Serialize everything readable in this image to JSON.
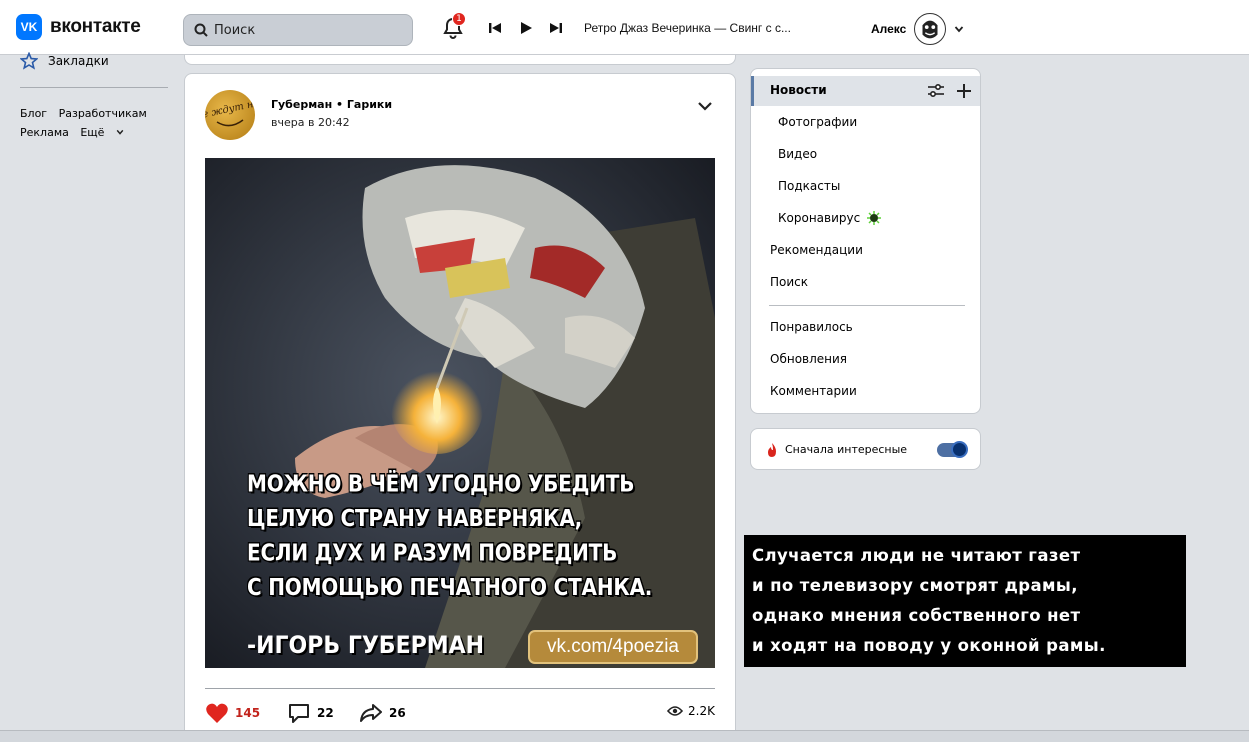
{
  "header": {
    "logo_mark": "VK",
    "logo_text": "вконтакте",
    "search_placeholder": "Поиск",
    "notifications_count": "1",
    "now_playing": "Ретро Джаз Вечеринка — Свинг с с...",
    "user_name": "Алекс"
  },
  "left_nav": {
    "bookmarks_label": "Закладки",
    "footer_links": [
      "Блог",
      "Разработчикам",
      "Реклама",
      "Ещё"
    ]
  },
  "post": {
    "author": "Губерман • Гарики",
    "time": "вчера в 20:42",
    "avatar_text": "Не ждут ни!",
    "quote_lines": [
      "МОЖНО В ЧЁМ УГОДНО УБЕДИТЬ",
      "ЦЕЛУЮ СТРАНУ НАВЕРНЯКА,",
      "ЕСЛИ ДУХ И РАЗУМ ПОВРЕДИТЬ",
      "С ПОМОЩЬЮ ПЕЧАТНОГО СТАНКА."
    ],
    "quote_author": "-ИГОРЬ ГУБЕРМАН",
    "source_badge": "vk.com/4poezia",
    "likes": "145",
    "comments": "22",
    "shares": "26",
    "views": "2.2K"
  },
  "feed_menu": {
    "items": {
      "news": "Новости",
      "photos": "Фотографии",
      "video": "Видео",
      "podcasts": "Подкасты",
      "coronavirus": "Коронавирус",
      "recommendations": "Рекомендации",
      "search": "Поиск",
      "liked": "Понравилось",
      "updates": "Обновления",
      "comments": "Комментарии"
    },
    "interesting_first": "Сначала интересные",
    "interesting_first_enabled": true
  },
  "poem_overlay": {
    "lines": [
      "Случается люди не читают газет",
      "и по телевизору смотрят драмы,",
      "однако мнения собственного нет",
      "и ходят на поводу у оконной рамы."
    ]
  },
  "colors": {
    "brand_blue": "#0077ff",
    "like_red": "#e0261f",
    "active_bar": "#5a7aa5"
  }
}
